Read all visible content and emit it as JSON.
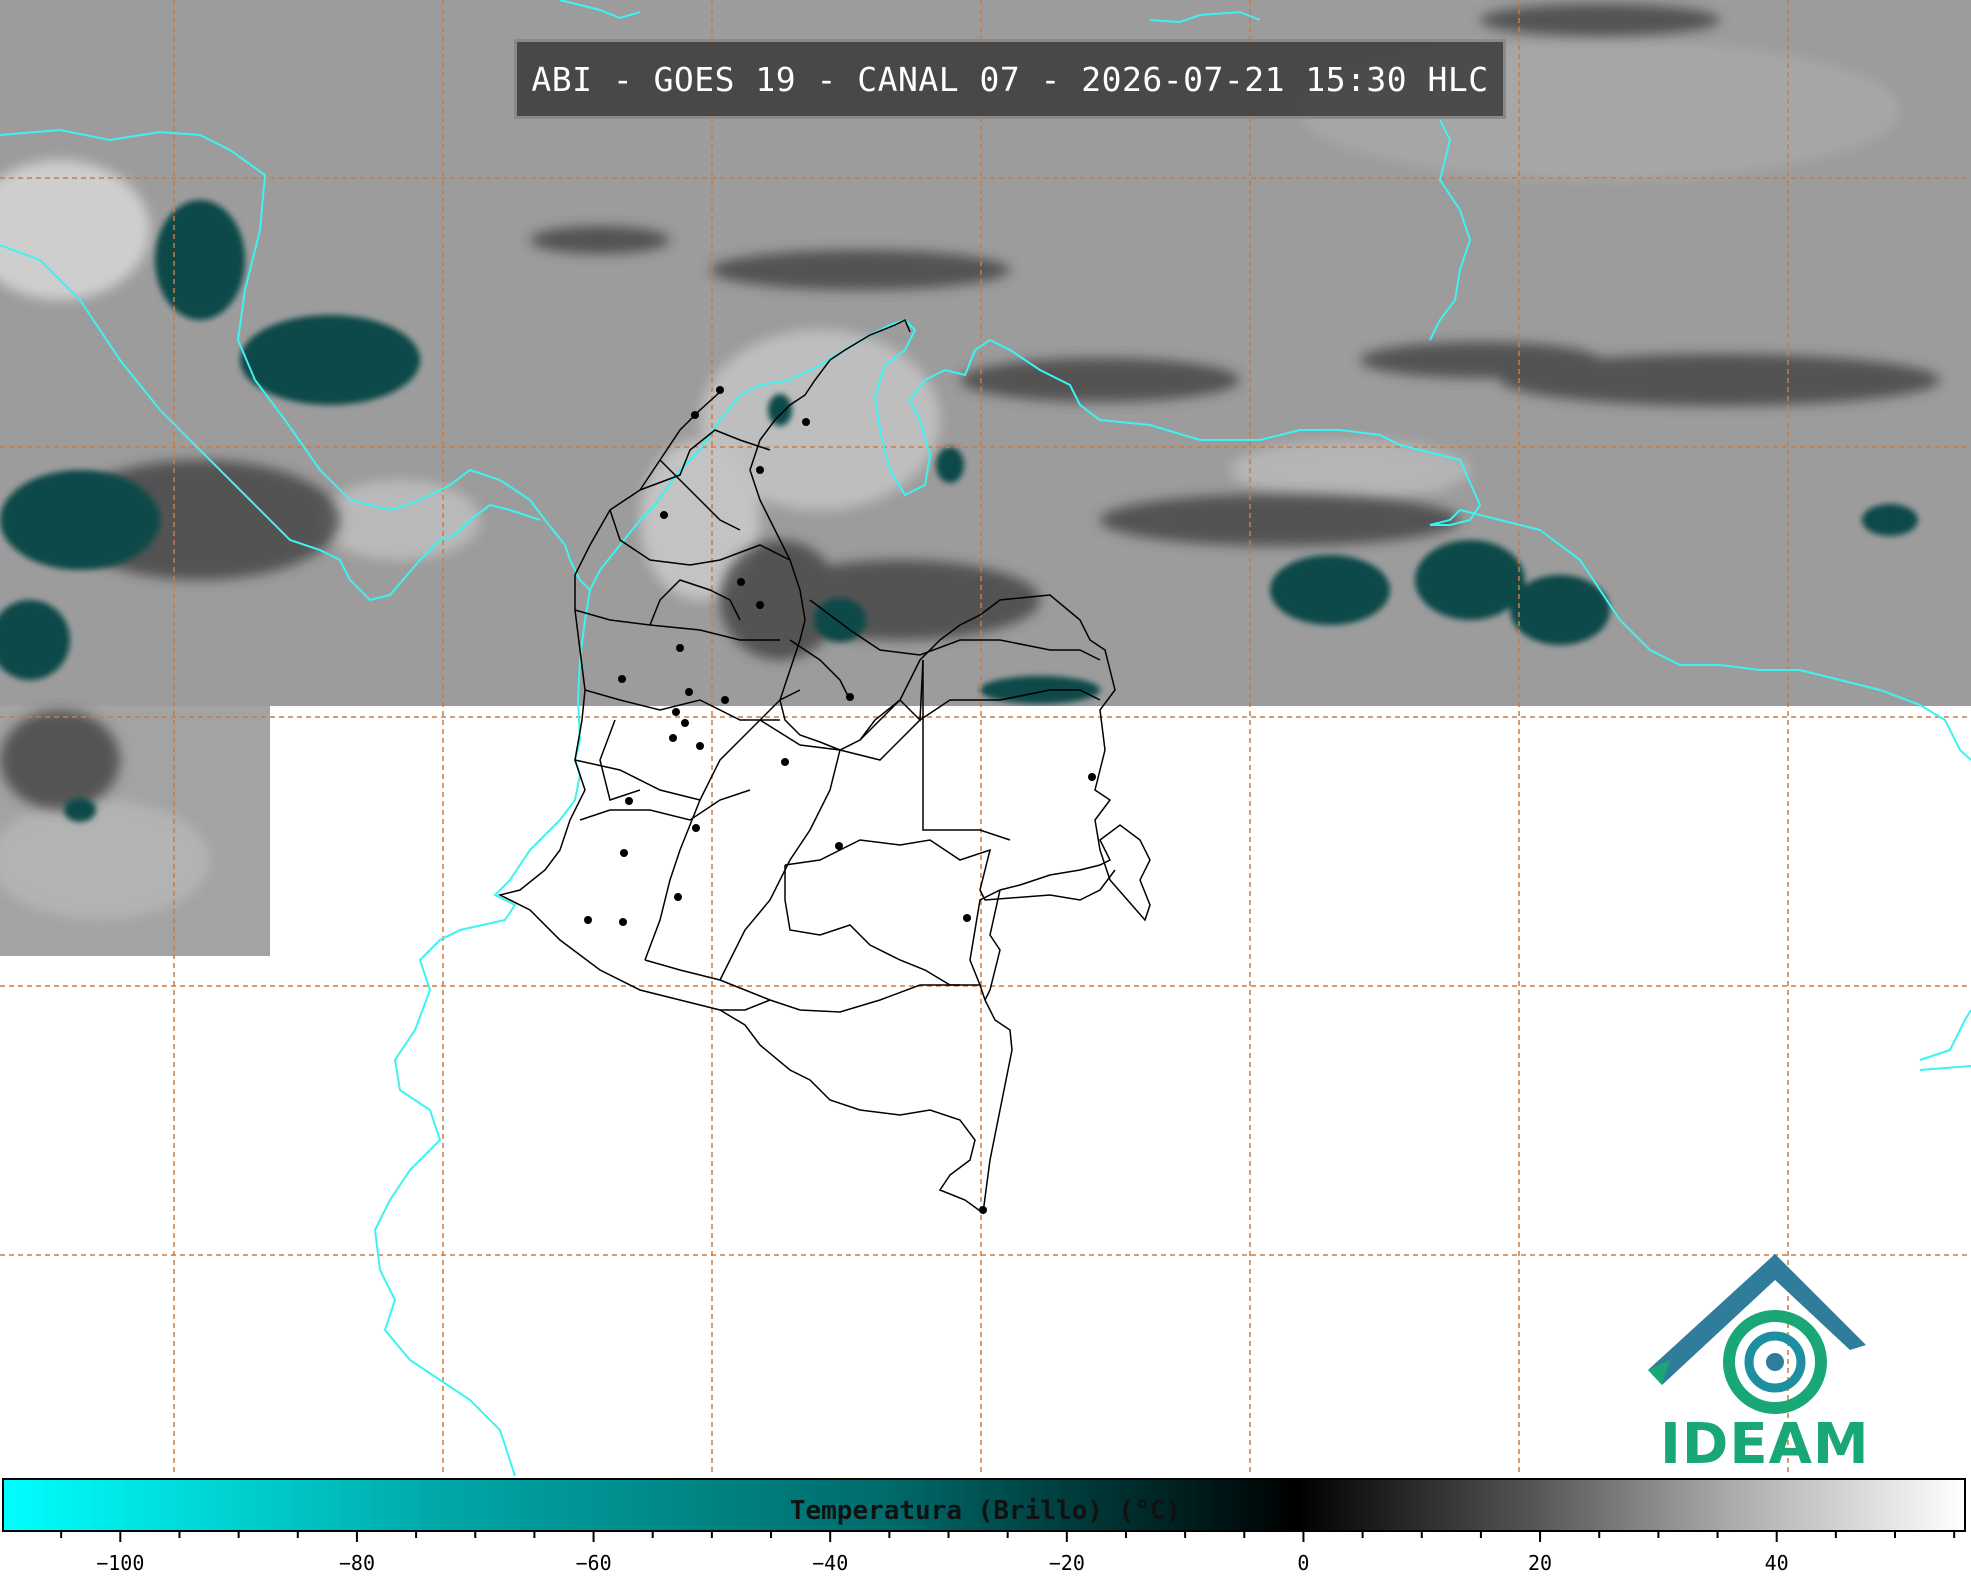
{
  "map": {
    "title": "ABI - GOES 19 - CANAL 07 - 2026-07-21 15:30 HLC",
    "logo_text": "IDEAM",
    "colorbar": {
      "label": "Temperatura (Brillo) (°C)",
      "ticks": [
        "−100",
        "−80",
        "−60",
        "−40",
        "−20",
        "0",
        "20",
        "40"
      ],
      "range": [
        -110,
        56
      ],
      "colors": [
        "#00ffff",
        "#006b6b",
        "#000000",
        "#ffffff"
      ]
    },
    "colors": {
      "coastline": "#3ff2f2",
      "grid": "#d07a3a",
      "borders": "#000000",
      "cloud_cold": "#0b4d4d"
    }
  }
}
